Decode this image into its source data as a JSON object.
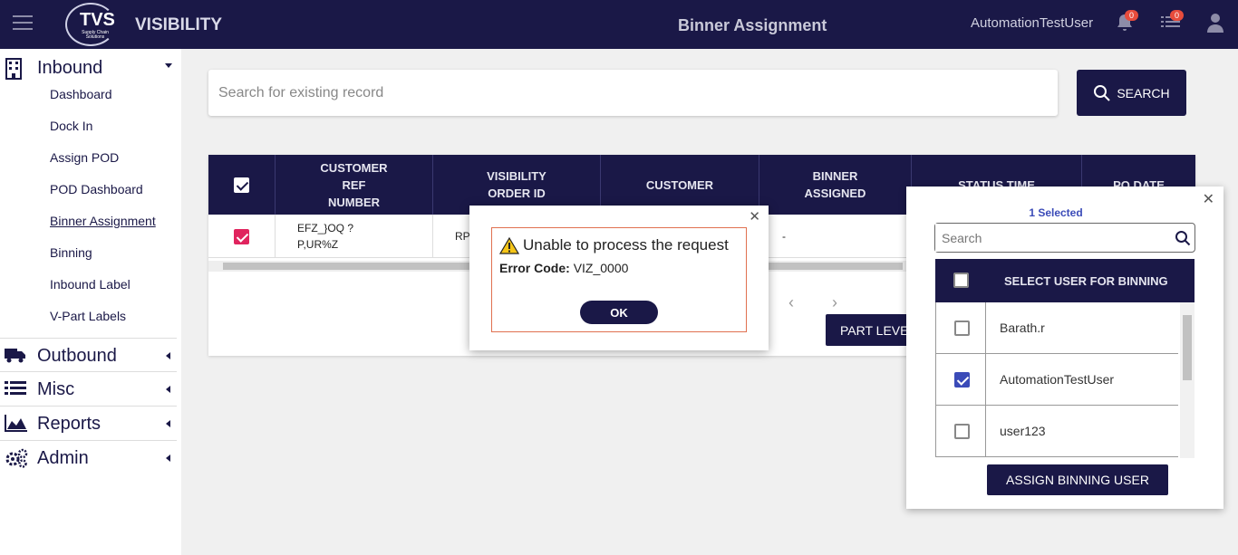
{
  "header": {
    "logo_text": "TVS",
    "logo_sub": "Supply Chain Solutions",
    "app_name": "VISIBILITY",
    "page_title": "Binner Assignment",
    "username": "AutomationTestUser",
    "notifications_count": "0",
    "tasks_count": "0"
  },
  "sidebar": {
    "inbound": {
      "label": "Inbound",
      "items": [
        "Dashboard",
        "Dock In",
        "Assign POD",
        "POD Dashboard",
        "Binner Assignment",
        "Binning",
        "Inbound Label",
        "V-Part Labels"
      ]
    },
    "outbound": "Outbound",
    "misc": "Misc",
    "reports": "Reports",
    "admin": "Admin"
  },
  "search": {
    "placeholder": "Search for existing record",
    "button": "SEARCH"
  },
  "table": {
    "headers": [
      "CUSTOMER REF NUMBER",
      "VISIBILITY ORDER ID",
      "CUSTOMER",
      "BINNER ASSIGNED",
      "STATUS TIME",
      "PO DATE"
    ],
    "row": {
      "customer_ref": "EFZ_}OQ ? P,UR%Z",
      "visibility_order_id": "RP...",
      "binner_assigned": "-"
    },
    "part_level_button": "PART LEVE"
  },
  "user_panel": {
    "selected_text": "1 Selected",
    "search_placeholder": "Search",
    "header": "SELECT USER FOR BINNING",
    "users": [
      "Barath.r",
      "AutomationTestUser",
      "user123"
    ],
    "assign_button": "ASSIGN BINNING USER"
  },
  "modal": {
    "title": "Unable to process the request",
    "error_label": "Error Code:",
    "error_code": "VIZ_0000",
    "ok": "OK"
  },
  "colors": {
    "brand": "#1a1847",
    "accent_pink": "#e0245e",
    "accent_blue": "#3b4bb8"
  }
}
